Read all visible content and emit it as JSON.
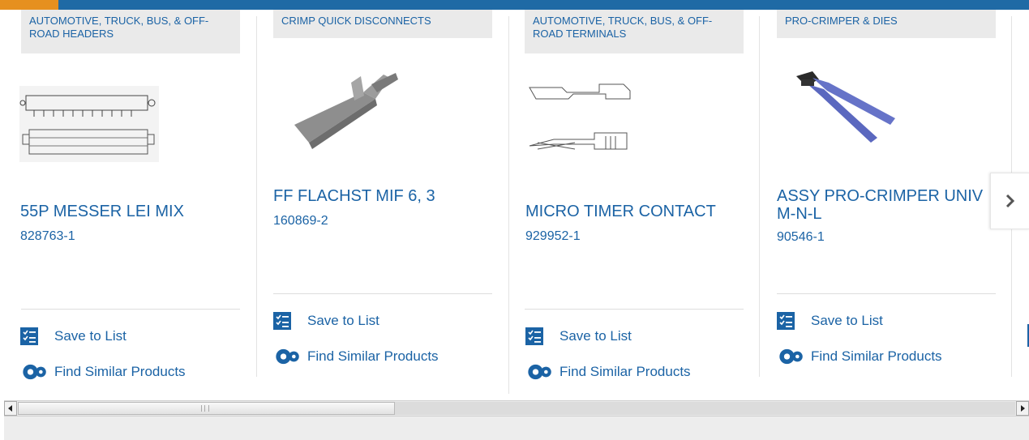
{
  "products": [
    {
      "category": "AUTOMOTIVE, TRUCK, BUS, & OFF-ROAD HEADERS",
      "title": "55P MESSER LEI MIX",
      "part_number": "828763-1",
      "save_label": "Save to List",
      "similar_label": "Find Similar Products"
    },
    {
      "category": "CRIMP QUICK DISCONNECTS",
      "title": "FF FLACHST MIF 6, 3",
      "part_number": "160869-2",
      "save_label": "Save to List",
      "similar_label": "Find Similar Products"
    },
    {
      "category": "AUTOMOTIVE, TRUCK, BUS, & OFF-ROAD TERMINALS",
      "title": "MICRO TIMER CONTACT",
      "part_number": "929952-1",
      "save_label": "Save to List",
      "similar_label": "Find Similar Products"
    },
    {
      "category": "PRO-CRIMPER & DIES",
      "title": "ASSY PRO-CRIMPER UNIV M-N-L",
      "part_number": "90546-1",
      "save_label": "Save to List",
      "similar_label": "Find Similar Products"
    }
  ],
  "colors": {
    "link": "#1b63a5",
    "topbar": "#1f6aa5",
    "accent": "#e6901f"
  },
  "icons": {
    "save": "checklist-icon",
    "similar": "gears-icon",
    "next": "chevron-right-icon"
  }
}
